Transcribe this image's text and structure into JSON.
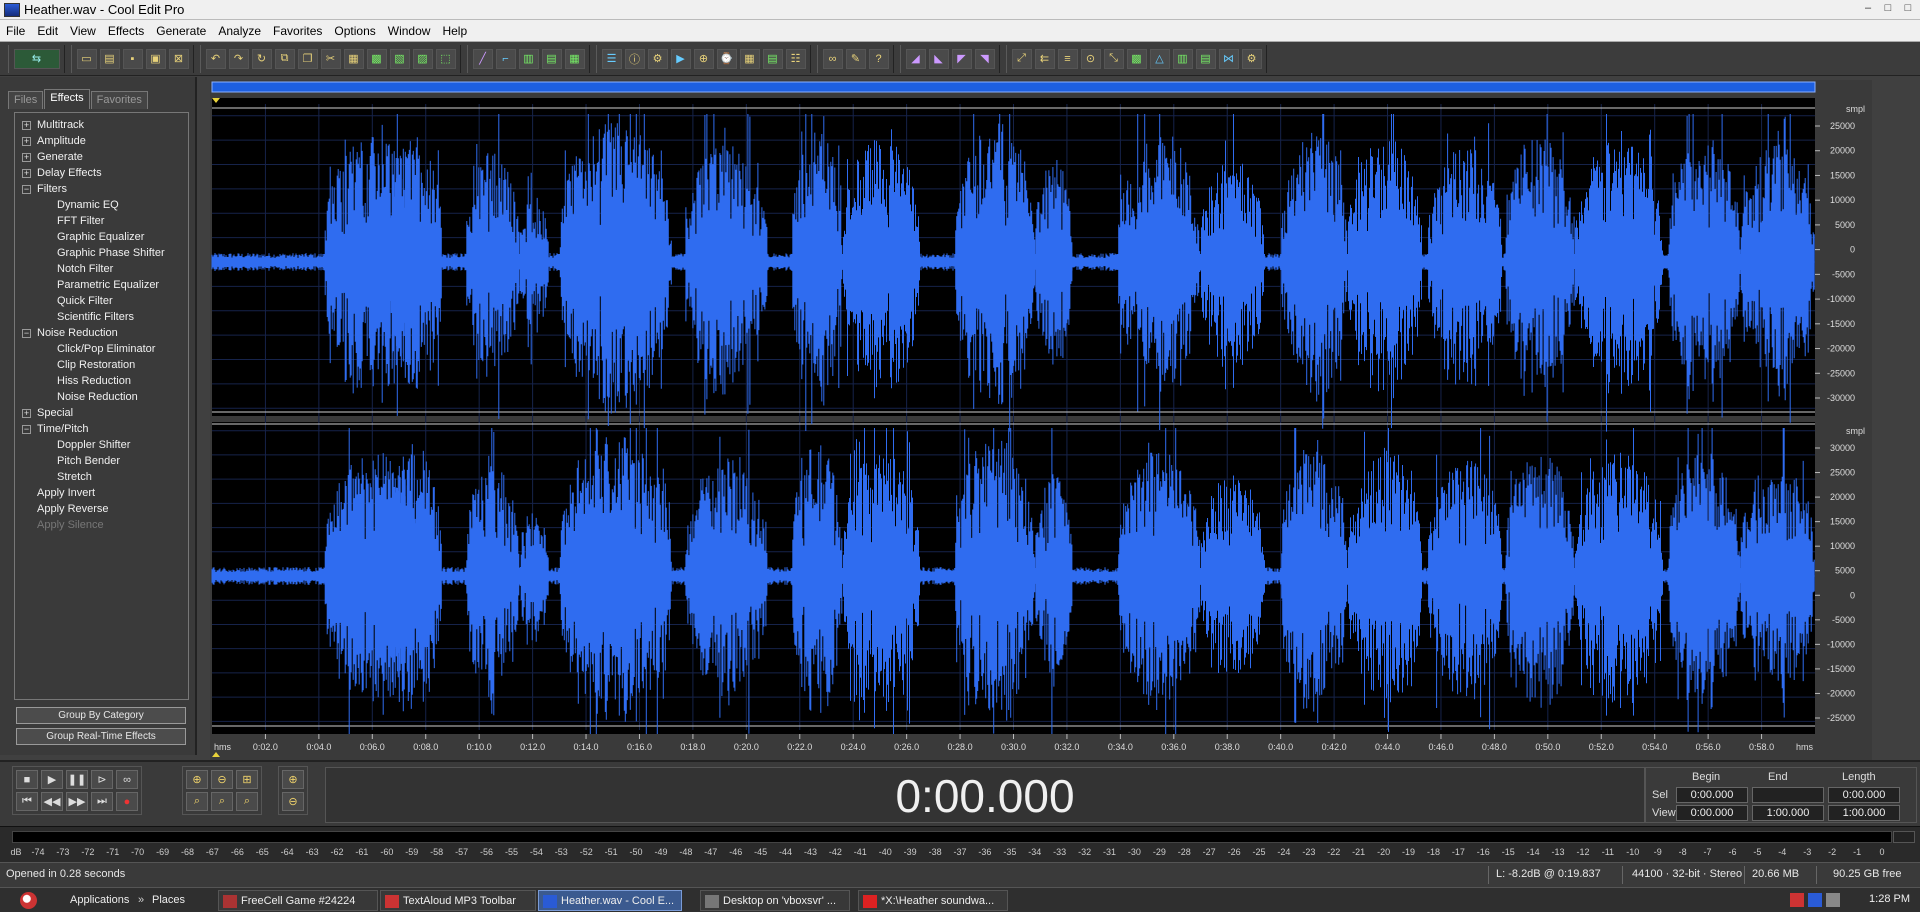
{
  "window": {
    "title": "Heather.wav - Cool Edit Pro",
    "minimize": "–",
    "maximize": "□",
    "close": "□"
  },
  "menu": [
    "File",
    "Edit",
    "View",
    "Effects",
    "Generate",
    "Analyze",
    "Favorites",
    "Options",
    "Window",
    "Help"
  ],
  "panel": {
    "tabs": [
      "Files",
      "Effects",
      "Favorites"
    ],
    "active_tab": "Effects",
    "tree": [
      {
        "label": "Multitrack",
        "level": 0,
        "expander": "+"
      },
      {
        "label": "Amplitude",
        "level": 0,
        "expander": "+"
      },
      {
        "label": "Generate",
        "level": 0,
        "expander": "+"
      },
      {
        "label": "Delay Effects",
        "level": 0,
        "expander": "+"
      },
      {
        "label": "Filters",
        "level": 0,
        "expander": "−"
      },
      {
        "label": "Dynamic EQ",
        "level": 1
      },
      {
        "label": "FFT Filter",
        "level": 1
      },
      {
        "label": "Graphic Equalizer",
        "level": 1
      },
      {
        "label": "Graphic Phase Shifter",
        "level": 1
      },
      {
        "label": "Notch Filter",
        "level": 1
      },
      {
        "label": "Parametric Equalizer",
        "level": 1
      },
      {
        "label": "Quick Filter",
        "level": 1
      },
      {
        "label": "Scientific Filters",
        "level": 1
      },
      {
        "label": "Noise Reduction",
        "level": 0,
        "expander": "−"
      },
      {
        "label": "Click/Pop Eliminator",
        "level": 1
      },
      {
        "label": "Clip Restoration",
        "level": 1
      },
      {
        "label": "Hiss Reduction",
        "level": 1
      },
      {
        "label": "Noise Reduction",
        "level": 1
      },
      {
        "label": "Special",
        "level": 0,
        "expander": "+"
      },
      {
        "label": "Time/Pitch",
        "level": 0,
        "expander": "−"
      },
      {
        "label": "Doppler Shifter",
        "level": 1
      },
      {
        "label": "Pitch Bender",
        "level": 1
      },
      {
        "label": "Stretch",
        "level": 1
      },
      {
        "label": "Apply Invert",
        "level": 0
      },
      {
        "label": "Apply Reverse",
        "level": 0
      },
      {
        "label": "Apply Silence",
        "level": 0,
        "disabled": true
      }
    ],
    "group_by_category": "Group By Category",
    "group_realtime": "Group Real-Time Effects"
  },
  "waveform": {
    "ruler_unit": "hms",
    "time_ticks": [
      "0:02.0",
      "0:04.0",
      "0:06.0",
      "0:08.0",
      "0:10.0",
      "0:12.0",
      "0:14.0",
      "0:16.0",
      "0:18.0",
      "0:20.0",
      "0:22.0",
      "0:24.0",
      "0:26.0",
      "0:28.0",
      "0:30.0",
      "0:32.0",
      "0:34.0",
      "0:36.0",
      "0:38.0",
      "0:40.0",
      "0:42.0",
      "0:44.0",
      "0:46.0",
      "0:48.0",
      "0:50.0",
      "0:52.0",
      "0:54.0",
      "0:56.0",
      "0:58.0"
    ],
    "amp_unit": "smpl",
    "amp_ticks_top": [
      "25000",
      "20000",
      "15000",
      "10000",
      "5000",
      "0",
      "-5000",
      "-10000",
      "-15000",
      "-20000",
      "-25000",
      "-30000"
    ],
    "amp_ticks_bottom": [
      "30000",
      "25000",
      "20000",
      "15000",
      "10000",
      "5000",
      "0",
      "-5000",
      "-10000",
      "-15000",
      "-20000",
      "-25000"
    ],
    "wave_color": "#2f6cf0",
    "background": "#000000"
  },
  "transport": {
    "time": "0:00.000"
  },
  "selview": {
    "headers": [
      "Begin",
      "End",
      "Length"
    ],
    "sel_label": "Sel",
    "view_label": "View",
    "sel": [
      "0:00.000",
      "",
      "0:00.000"
    ],
    "view": [
      "0:00.000",
      "1:00.000",
      "1:00.000"
    ]
  },
  "level_meter": {
    "unit": "dB",
    "ticks": [
      "-74",
      "-73",
      "-72",
      "-71",
      "-70",
      "-69",
      "-68",
      "-67",
      "-66",
      "-65",
      "-64",
      "-63",
      "-62",
      "-61",
      "-60",
      "-59",
      "-58",
      "-57",
      "-56",
      "-55",
      "-54",
      "-53",
      "-52",
      "-51",
      "-50",
      "-49",
      "-48",
      "-47",
      "-46",
      "-45",
      "-44",
      "-43",
      "-42",
      "-41",
      "-40",
      "-39",
      "-38",
      "-37",
      "-36",
      "-35",
      "-34",
      "-33",
      "-32",
      "-31",
      "-30",
      "-29",
      "-28",
      "-27",
      "-26",
      "-25",
      "-24",
      "-23",
      "-22",
      "-21",
      "-20",
      "-19",
      "-18",
      "-17",
      "-16",
      "-15",
      "-14",
      "-13",
      "-12",
      "-11",
      "-10",
      "-9",
      "-8",
      "-7",
      "-6",
      "-5",
      "-4",
      "-3",
      "-2",
      "-1",
      "0"
    ]
  },
  "status": {
    "message": "Opened in 0.28 seconds",
    "cursor": "L: -8.2dB @  0:19.837",
    "format": "44100 · 32-bit · Stereo",
    "size": "20.66 MB",
    "free": "90.25 GB free"
  },
  "taskbar": {
    "applications": "Applications",
    "places": "Places",
    "tasks": [
      {
        "label": "FreeCell Game #24224",
        "active": false
      },
      {
        "label": "TextAloud MP3 Toolbar",
        "active": false
      },
      {
        "label": "Heather.wav - Cool E...",
        "active": true
      },
      {
        "label": "Desktop on 'vboxsvr' ...",
        "active": false
      },
      {
        "label": "*X:\\Heather soundwa...",
        "active": false
      }
    ],
    "clock": "1:28 PM"
  }
}
